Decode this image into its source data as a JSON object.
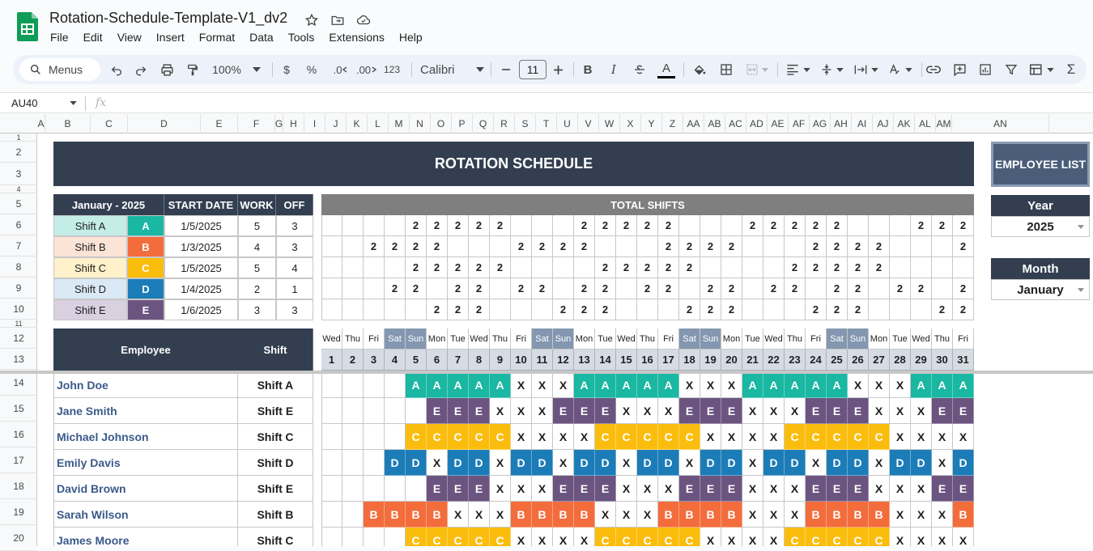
{
  "app": {
    "doc_title": "Rotation-Schedule-Template-V1_dv2",
    "menus": [
      "File",
      "Edit",
      "View",
      "Insert",
      "Format",
      "Data",
      "Tools",
      "Extensions",
      "Help"
    ]
  },
  "toolbar": {
    "search_label": "Menus",
    "zoom": "100%",
    "currency": "$",
    "percent": "%",
    "dec_decrease": ".0",
    "dec_increase": ".00",
    "number_format": "123",
    "font": "Calibri",
    "font_size": "11",
    "bold": "B",
    "italic": "I",
    "text_color_letter": "A"
  },
  "formula_bar": {
    "name_box": "AU40",
    "fx": "fx"
  },
  "columns": [
    "A",
    "B",
    "C",
    "D",
    "E",
    "F",
    "G",
    "H",
    "I",
    "J",
    "K",
    "L",
    "M",
    "N",
    "O",
    "P",
    "Q",
    "R",
    "S",
    "T",
    "U",
    "V",
    "W",
    "X",
    "Y",
    "Z",
    "AA",
    "AB",
    "AC",
    "AD",
    "AE",
    "AF",
    "AG",
    "AH",
    "AI",
    "AJ",
    "AK",
    "AL",
    "AM",
    "AN"
  ],
  "rows": [
    "1",
    "2",
    "3",
    "4",
    "5",
    "6",
    "7",
    "8",
    "9",
    "10",
    "11",
    "12",
    "13",
    "14",
    "15",
    "16",
    "17",
    "18",
    "19",
    "20"
  ],
  "sheet": {
    "banner_title": "ROTATION SCHEDULE",
    "employee_list_button": "EMPLOYEE LIST",
    "year_label": "Year",
    "year_value": "2025",
    "month_label": "Month",
    "month_value": "January",
    "shift_table": {
      "header_period": "January - 2025",
      "header_start": "START DATE",
      "header_work": "WORK",
      "header_off": "OFF",
      "rows": [
        {
          "name": "Shift A",
          "code": "A",
          "start": "1/5/2025",
          "work": "5",
          "off": "3",
          "light": "#c4ede8",
          "color": "#1ab7a2"
        },
        {
          "name": "Shift B",
          "code": "B",
          "start": "1/3/2025",
          "work": "4",
          "off": "3",
          "light": "#fbe3d6",
          "color": "#f36d3c"
        },
        {
          "name": "Shift C",
          "code": "C",
          "start": "1/5/2025",
          "work": "5",
          "off": "4",
          "light": "#fff1c9",
          "color": "#fbbd0d"
        },
        {
          "name": "Shift D",
          "code": "D",
          "start": "1/4/2025",
          "work": "2",
          "off": "1",
          "light": "#dbe8f5",
          "color": "#1c7cb7"
        },
        {
          "name": "Shift E",
          "code": "E",
          "start": "1/6/2025",
          "work": "3",
          "off": "3",
          "light": "#d9d0e0",
          "color": "#6b5580"
        }
      ]
    },
    "total_shifts_label": "TOTAL SHIFTS",
    "totals": [
      [
        "",
        "",
        "",
        "",
        "2",
        "2",
        "2",
        "2",
        "2",
        "",
        "",
        "",
        "2",
        "2",
        "2",
        "2",
        "2",
        "",
        "",
        "",
        "2",
        "2",
        "2",
        "2",
        "2",
        "",
        "",
        "",
        "2",
        "2",
        "2"
      ],
      [
        "",
        "",
        "2",
        "2",
        "2",
        "2",
        "",
        "",
        "",
        "2",
        "2",
        "2",
        "2",
        "",
        "",
        "",
        "2",
        "2",
        "2",
        "2",
        "",
        "",
        "",
        "2",
        "2",
        "2",
        "2",
        "",
        "",
        "",
        "2"
      ],
      [
        "",
        "",
        "",
        "",
        "2",
        "2",
        "2",
        "2",
        "2",
        "",
        "",
        "",
        "",
        "2",
        "2",
        "2",
        "2",
        "2",
        "",
        "",
        "",
        "",
        "2",
        "2",
        "2",
        "2",
        "2",
        "",
        "",
        "",
        ""
      ],
      [
        "",
        "",
        "",
        "2",
        "2",
        "",
        "2",
        "2",
        "",
        "2",
        "2",
        "",
        "2",
        "2",
        "",
        "2",
        "2",
        "",
        "2",
        "2",
        "",
        "2",
        "2",
        "",
        "2",
        "2",
        "",
        "2",
        "2",
        "",
        "2"
      ],
      [
        "",
        "",
        "",
        "",
        "",
        "2",
        "2",
        "2",
        "",
        "",
        "",
        "2",
        "2",
        "2",
        "",
        "",
        "",
        "2",
        "2",
        "2",
        "",
        "",
        "",
        "2",
        "2",
        "2",
        "",
        "",
        "",
        "2",
        "2"
      ]
    ],
    "day_names": [
      "Wed",
      "Thu",
      "Fri",
      "Sat",
      "Sun",
      "Mon",
      "Tue",
      "Wed",
      "Thu",
      "Fri",
      "Sat",
      "Sun",
      "Mon",
      "Tue",
      "Wed",
      "Thu",
      "Fri",
      "Sat",
      "Sun",
      "Mon",
      "Tue",
      "Wed",
      "Thu",
      "Fri",
      "Sat",
      "Sun",
      "Mon",
      "Tue",
      "Wed",
      "Thu",
      "Fri"
    ],
    "day_numbers": [
      "1",
      "2",
      "3",
      "4",
      "5",
      "6",
      "7",
      "8",
      "9",
      "10",
      "11",
      "12",
      "13",
      "14",
      "15",
      "16",
      "17",
      "18",
      "19",
      "20",
      "21",
      "22",
      "23",
      "24",
      "25",
      "26",
      "27",
      "28",
      "29",
      "30",
      "31"
    ],
    "employee_header": "Employee",
    "shift_header": "Shift",
    "employees": [
      {
        "name": "John Doe",
        "shift": "Shift A",
        "code": "A",
        "days": [
          "",
          "",
          "",
          "",
          "A",
          "A",
          "A",
          "A",
          "A",
          "X",
          "X",
          "X",
          "A",
          "A",
          "A",
          "A",
          "A",
          "X",
          "X",
          "X",
          "A",
          "A",
          "A",
          "A",
          "A",
          "X",
          "X",
          "X",
          "A",
          "A",
          "A"
        ]
      },
      {
        "name": "Jane Smith",
        "shift": "Shift E",
        "code": "E",
        "days": [
          "",
          "",
          "",
          "",
          "",
          "E",
          "E",
          "E",
          "X",
          "X",
          "X",
          "E",
          "E",
          "E",
          "X",
          "X",
          "X",
          "E",
          "E",
          "E",
          "X",
          "X",
          "X",
          "E",
          "E",
          "E",
          "X",
          "X",
          "X",
          "E",
          "E"
        ]
      },
      {
        "name": "Michael Johnson",
        "shift": "Shift C",
        "code": "C",
        "days": [
          "",
          "",
          "",
          "",
          "C",
          "C",
          "C",
          "C",
          "C",
          "X",
          "X",
          "X",
          "X",
          "C",
          "C",
          "C",
          "C",
          "C",
          "X",
          "X",
          "X",
          "X",
          "C",
          "C",
          "C",
          "C",
          "C",
          "X",
          "X",
          "X",
          "X"
        ]
      },
      {
        "name": "Emily Davis",
        "shift": "Shift D",
        "code": "D",
        "days": [
          "",
          "",
          "",
          "D",
          "D",
          "X",
          "D",
          "D",
          "X",
          "D",
          "D",
          "X",
          "D",
          "D",
          "X",
          "D",
          "D",
          "X",
          "D",
          "D",
          "X",
          "D",
          "D",
          "X",
          "D",
          "D",
          "X",
          "D",
          "D",
          "X",
          "D"
        ]
      },
      {
        "name": "David Brown",
        "shift": "Shift E",
        "code": "E",
        "days": [
          "",
          "",
          "",
          "",
          "",
          "E",
          "E",
          "E",
          "X",
          "X",
          "X",
          "E",
          "E",
          "E",
          "X",
          "X",
          "X",
          "E",
          "E",
          "E",
          "X",
          "X",
          "X",
          "E",
          "E",
          "E",
          "X",
          "X",
          "X",
          "E",
          "E"
        ]
      },
      {
        "name": "Sarah Wilson",
        "shift": "Shift B",
        "code": "B",
        "days": [
          "",
          "",
          "B",
          "B",
          "B",
          "B",
          "X",
          "X",
          "X",
          "B",
          "B",
          "B",
          "B",
          "X",
          "X",
          "X",
          "B",
          "B",
          "B",
          "B",
          "X",
          "X",
          "X",
          "B",
          "B",
          "B",
          "B",
          "X",
          "X",
          "X",
          "B"
        ]
      },
      {
        "name": "James Moore",
        "shift": "Shift C",
        "code": "C",
        "days": [
          "",
          "",
          "",
          "",
          "C",
          "C",
          "C",
          "C",
          "C",
          "X",
          "X",
          "X",
          "X",
          "C",
          "C",
          "C",
          "C",
          "C",
          "X",
          "X",
          "X",
          "X",
          "C",
          "C",
          "C",
          "C",
          "C",
          "X",
          "X",
          "X",
          "X"
        ]
      }
    ]
  },
  "colors": {
    "header_dark": "#333f50",
    "weekend": "#8497b0",
    "day_number_bg": "#d6dce4",
    "employee_name": "#3a5a8a"
  }
}
